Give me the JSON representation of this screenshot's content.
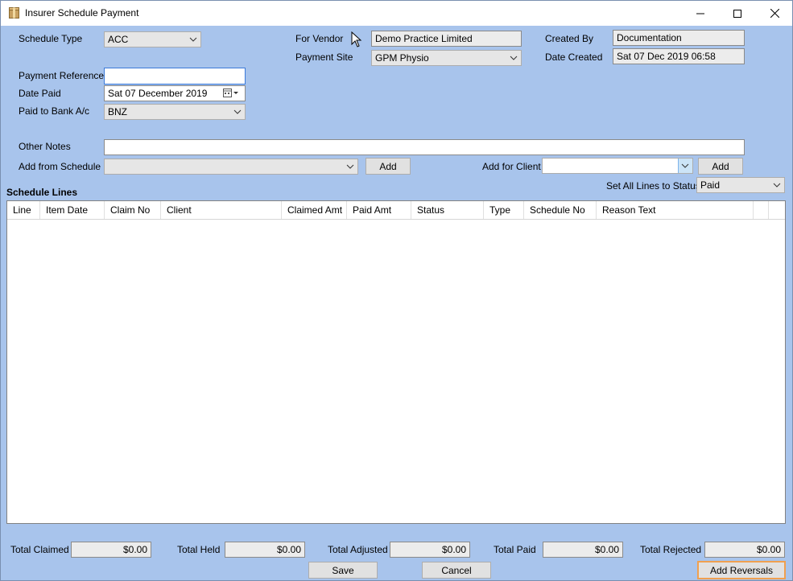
{
  "window": {
    "title": "Insurer Schedule Payment",
    "controls": [
      "minimize",
      "maximize",
      "close"
    ]
  },
  "form": {
    "schedule_type": {
      "label": "Schedule Type",
      "value": "ACC"
    },
    "for_vendor": {
      "label": "For Vendor",
      "value": "Demo Practice Limited"
    },
    "payment_site": {
      "label": "Payment Site",
      "value": "GPM Physio"
    },
    "created_by": {
      "label": "Created By",
      "value": "Documentation"
    },
    "date_created": {
      "label": "Date Created",
      "value": "Sat 07 Dec 2019 06:58"
    },
    "payment_reference": {
      "label": "Payment Reference",
      "value": ""
    },
    "date_paid": {
      "label": "Date Paid",
      "value": "Sat  07 December 2019"
    },
    "paid_to_bank": {
      "label": "Paid to Bank A/c",
      "value": "BNZ"
    },
    "other_notes": {
      "label": "Other Notes",
      "value": ""
    },
    "add_from_schedule": {
      "label": "Add from Schedule",
      "value": "",
      "button": "Add"
    },
    "add_for_client": {
      "label": "Add for Client",
      "value": "",
      "button": "Add"
    },
    "set_all_status": {
      "label": "Set All Lines to Status",
      "value": "Paid"
    }
  },
  "schedule_lines": {
    "title": "Schedule Lines",
    "columns": [
      "Line",
      "Item Date",
      "Claim No",
      "Client",
      "Claimed Amt",
      "Paid Amt",
      "Status",
      "Type",
      "Schedule No",
      "Reason Text"
    ],
    "rows": []
  },
  "totals": {
    "claimed": {
      "label": "Total Claimed",
      "value": "$0.00"
    },
    "held": {
      "label": "Total Held",
      "value": "$0.00"
    },
    "adjusted": {
      "label": "Total Adjusted",
      "value": "$0.00"
    },
    "paid": {
      "label": "Total Paid",
      "value": "$0.00"
    },
    "rejected": {
      "label": "Total Rejected",
      "value": "$0.00"
    }
  },
  "actions": {
    "save": "Save",
    "cancel": "Cancel",
    "add_reversals": "Add Reversals"
  },
  "colors": {
    "background": "#a8c4ec",
    "accent_border": "#f0a050",
    "focus_border": "#3b7ad9"
  }
}
